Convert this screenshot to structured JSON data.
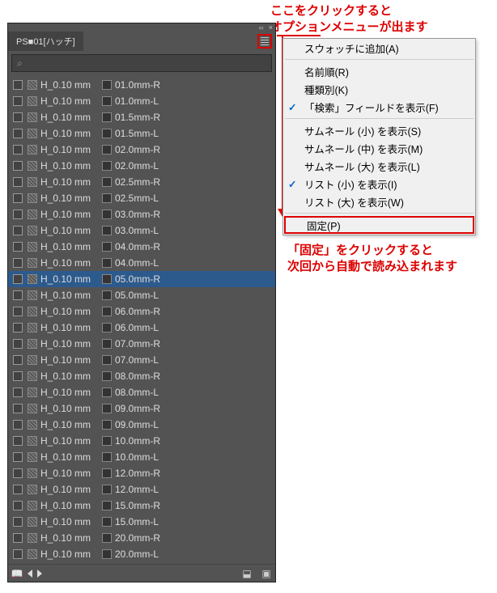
{
  "annotations": {
    "top_line1": "ここをクリックすると",
    "top_line2": "オプションメニューが出ます",
    "bottom_line1": "「固定」をクリックすると",
    "bottom_line2": "次回から自動で読み込まれます"
  },
  "panel": {
    "tab_title": "PS■01[ハッチ]",
    "search_placeholder": "⌕",
    "close_glyph": "×",
    "collapse_glyph": "‹‹",
    "book_glyph": "📖",
    "rows": [
      {
        "c1": "H_0.10 mm",
        "c2": "01.0mm-R",
        "sel": false
      },
      {
        "c1": "H_0.10 mm",
        "c2": "01.0mm-L",
        "sel": false
      },
      {
        "c1": "H_0.10 mm",
        "c2": "01.5mm-R",
        "sel": false
      },
      {
        "c1": "H_0.10 mm",
        "c2": "01.5mm-L",
        "sel": false
      },
      {
        "c1": "H_0.10 mm",
        "c2": "02.0mm-R",
        "sel": false
      },
      {
        "c1": "H_0.10 mm",
        "c2": "02.0mm-L",
        "sel": false
      },
      {
        "c1": "H_0.10 mm",
        "c2": "02.5mm-R",
        "sel": false
      },
      {
        "c1": "H_0.10 mm",
        "c2": "02.5mm-L",
        "sel": false
      },
      {
        "c1": "H_0.10 mm",
        "c2": "03.0mm-R",
        "sel": false
      },
      {
        "c1": "H_0.10 mm",
        "c2": "03.0mm-L",
        "sel": false
      },
      {
        "c1": "H_0.10 mm",
        "c2": "04.0mm-R",
        "sel": false
      },
      {
        "c1": "H_0.10 mm",
        "c2": "04.0mm-L",
        "sel": false
      },
      {
        "c1": "H_0.10 mm",
        "c2": "05.0mm-R",
        "sel": true
      },
      {
        "c1": "H_0.10 mm",
        "c2": "05.0mm-L",
        "sel": false
      },
      {
        "c1": "H_0.10 mm",
        "c2": "06.0mm-R",
        "sel": false
      },
      {
        "c1": "H_0.10 mm",
        "c2": "06.0mm-L",
        "sel": false
      },
      {
        "c1": "H_0.10 mm",
        "c2": "07.0mm-R",
        "sel": false
      },
      {
        "c1": "H_0.10 mm",
        "c2": "07.0mm-L",
        "sel": false
      },
      {
        "c1": "H_0.10 mm",
        "c2": "08.0mm-R",
        "sel": false
      },
      {
        "c1": "H_0.10 mm",
        "c2": "08.0mm-L",
        "sel": false
      },
      {
        "c1": "H_0.10 mm",
        "c2": "09.0mm-R",
        "sel": false
      },
      {
        "c1": "H_0.10 mm",
        "c2": "09.0mm-L",
        "sel": false
      },
      {
        "c1": "H_0.10 mm",
        "c2": "10.0mm-R",
        "sel": false
      },
      {
        "c1": "H_0.10 mm",
        "c2": "10.0mm-L",
        "sel": false
      },
      {
        "c1": "H_0.10 mm",
        "c2": "12.0mm-R",
        "sel": false
      },
      {
        "c1": "H_0.10 mm",
        "c2": "12.0mm-L",
        "sel": false
      },
      {
        "c1": "H_0.10 mm",
        "c2": "15.0mm-R",
        "sel": false
      },
      {
        "c1": "H_0.10 mm",
        "c2": "15.0mm-L",
        "sel": false
      },
      {
        "c1": "H_0.10 mm",
        "c2": "20.0mm-R",
        "sel": false
      },
      {
        "c1": "H_0.10 mm",
        "c2": "20.0mm-L",
        "sel": false
      }
    ]
  },
  "menu": {
    "items": [
      {
        "label": "スウォッチに追加(A)",
        "checked": false
      },
      {
        "sep": true
      },
      {
        "label": "名前順(R)",
        "checked": false
      },
      {
        "label": "種類別(K)",
        "checked": false
      },
      {
        "label": "「検索」フィールドを表示(F)",
        "checked": true
      },
      {
        "sep": true
      },
      {
        "label": "サムネール (小) を表示(S)",
        "checked": false
      },
      {
        "label": "サムネール (中) を表示(M)",
        "checked": false
      },
      {
        "label": "サムネール (大) を表示(L)",
        "checked": false
      },
      {
        "label": "リスト (小) を表示(I)",
        "checked": true
      },
      {
        "label": "リスト (大) を表示(W)",
        "checked": false
      },
      {
        "sep": true
      },
      {
        "label": "固定(P)",
        "checked": false,
        "highlight": true
      }
    ]
  }
}
